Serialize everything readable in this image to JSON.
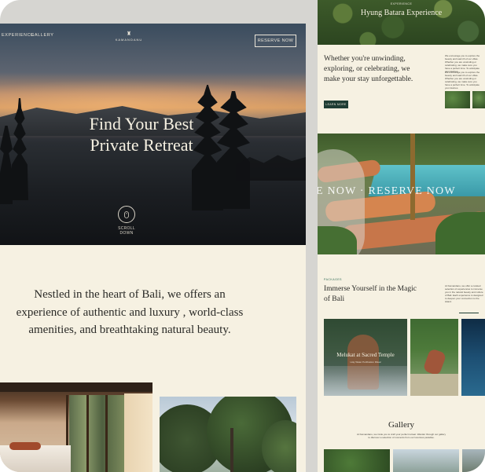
{
  "left": {
    "nav": {
      "experience": "EXPERIENCE",
      "gallery": "GALLERY",
      "reserve": "RESERVE NOW"
    },
    "logo": {
      "mark": "♜",
      "name": "KAMANDANU"
    },
    "hero": {
      "title": "Find Your Best\nPrivate Retreat",
      "scroll_label": "SCROLL\nDOWN"
    },
    "intro": "Nestled in the heart of Bali, we offers an experience of authentic and luxury , world-class amenities, and breathtaking natural beauty."
  },
  "right": {
    "banner": {
      "tag": "EXPERIENCE",
      "title": "Hyung Batara Experience"
    },
    "welcome": {
      "heading": "Whether you're unwinding, exploring, or celebrating, we make your stay unforgettable.",
      "button": "LEARN MORE"
    },
    "fine_a": "We encourage you to explore the beauty and warmth of our villas. Whether you are unwinding or celebrating, we make sure you have a perfect time. To anticipate your desires.",
    "fine_b": "We encourage you to explore the beauty and warmth of our villas. Whether you are unwinding or celebrating, we make sure you have a perfect time. To anticipate your desires.",
    "marquee": "E NOW · RESERVE NOW",
    "packages": {
      "tag": "PACKAGES",
      "heading": "Immerse Yourself in the Magic of Bali",
      "blurb": "At Kamandanu, we offer a curated selection of experiences to immerse you in the natural beauty and culture of Bali. Each experience is designed to deepen your connection to the island."
    },
    "card": {
      "title": "Melukat at Sacred Temple",
      "sub": "Holy Water Purification Ritual"
    },
    "gallery": {
      "title": "Gallery",
      "desc": "At Kamandanu, we invite you to craft your perfect retreat. Wander through our gallery to discover a selection of moments from our luxurious paradise."
    }
  }
}
